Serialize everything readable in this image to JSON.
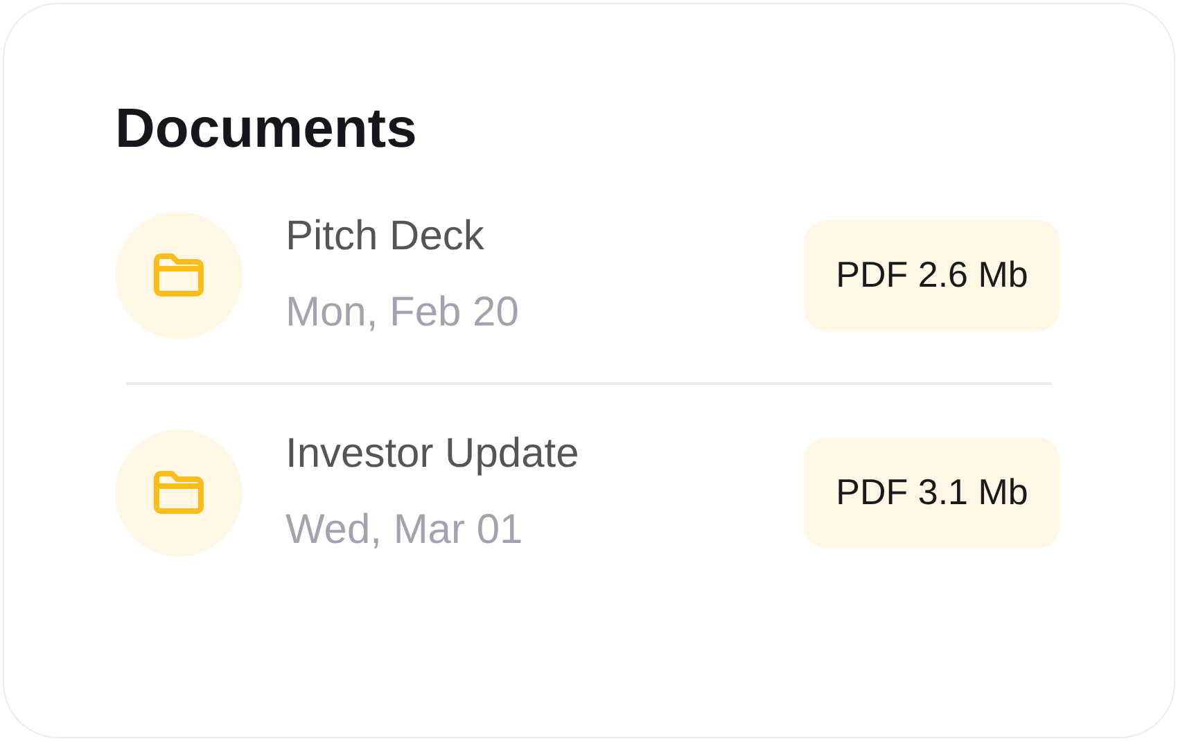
{
  "title": "Documents",
  "documents": [
    {
      "name": "Pitch Deck",
      "date": "Mon, Feb 20",
      "file": "PDF 2.6 Mb"
    },
    {
      "name": "Investor Update",
      "date": "Wed, Mar 01",
      "file": "PDF 3.1 Mb"
    }
  ]
}
